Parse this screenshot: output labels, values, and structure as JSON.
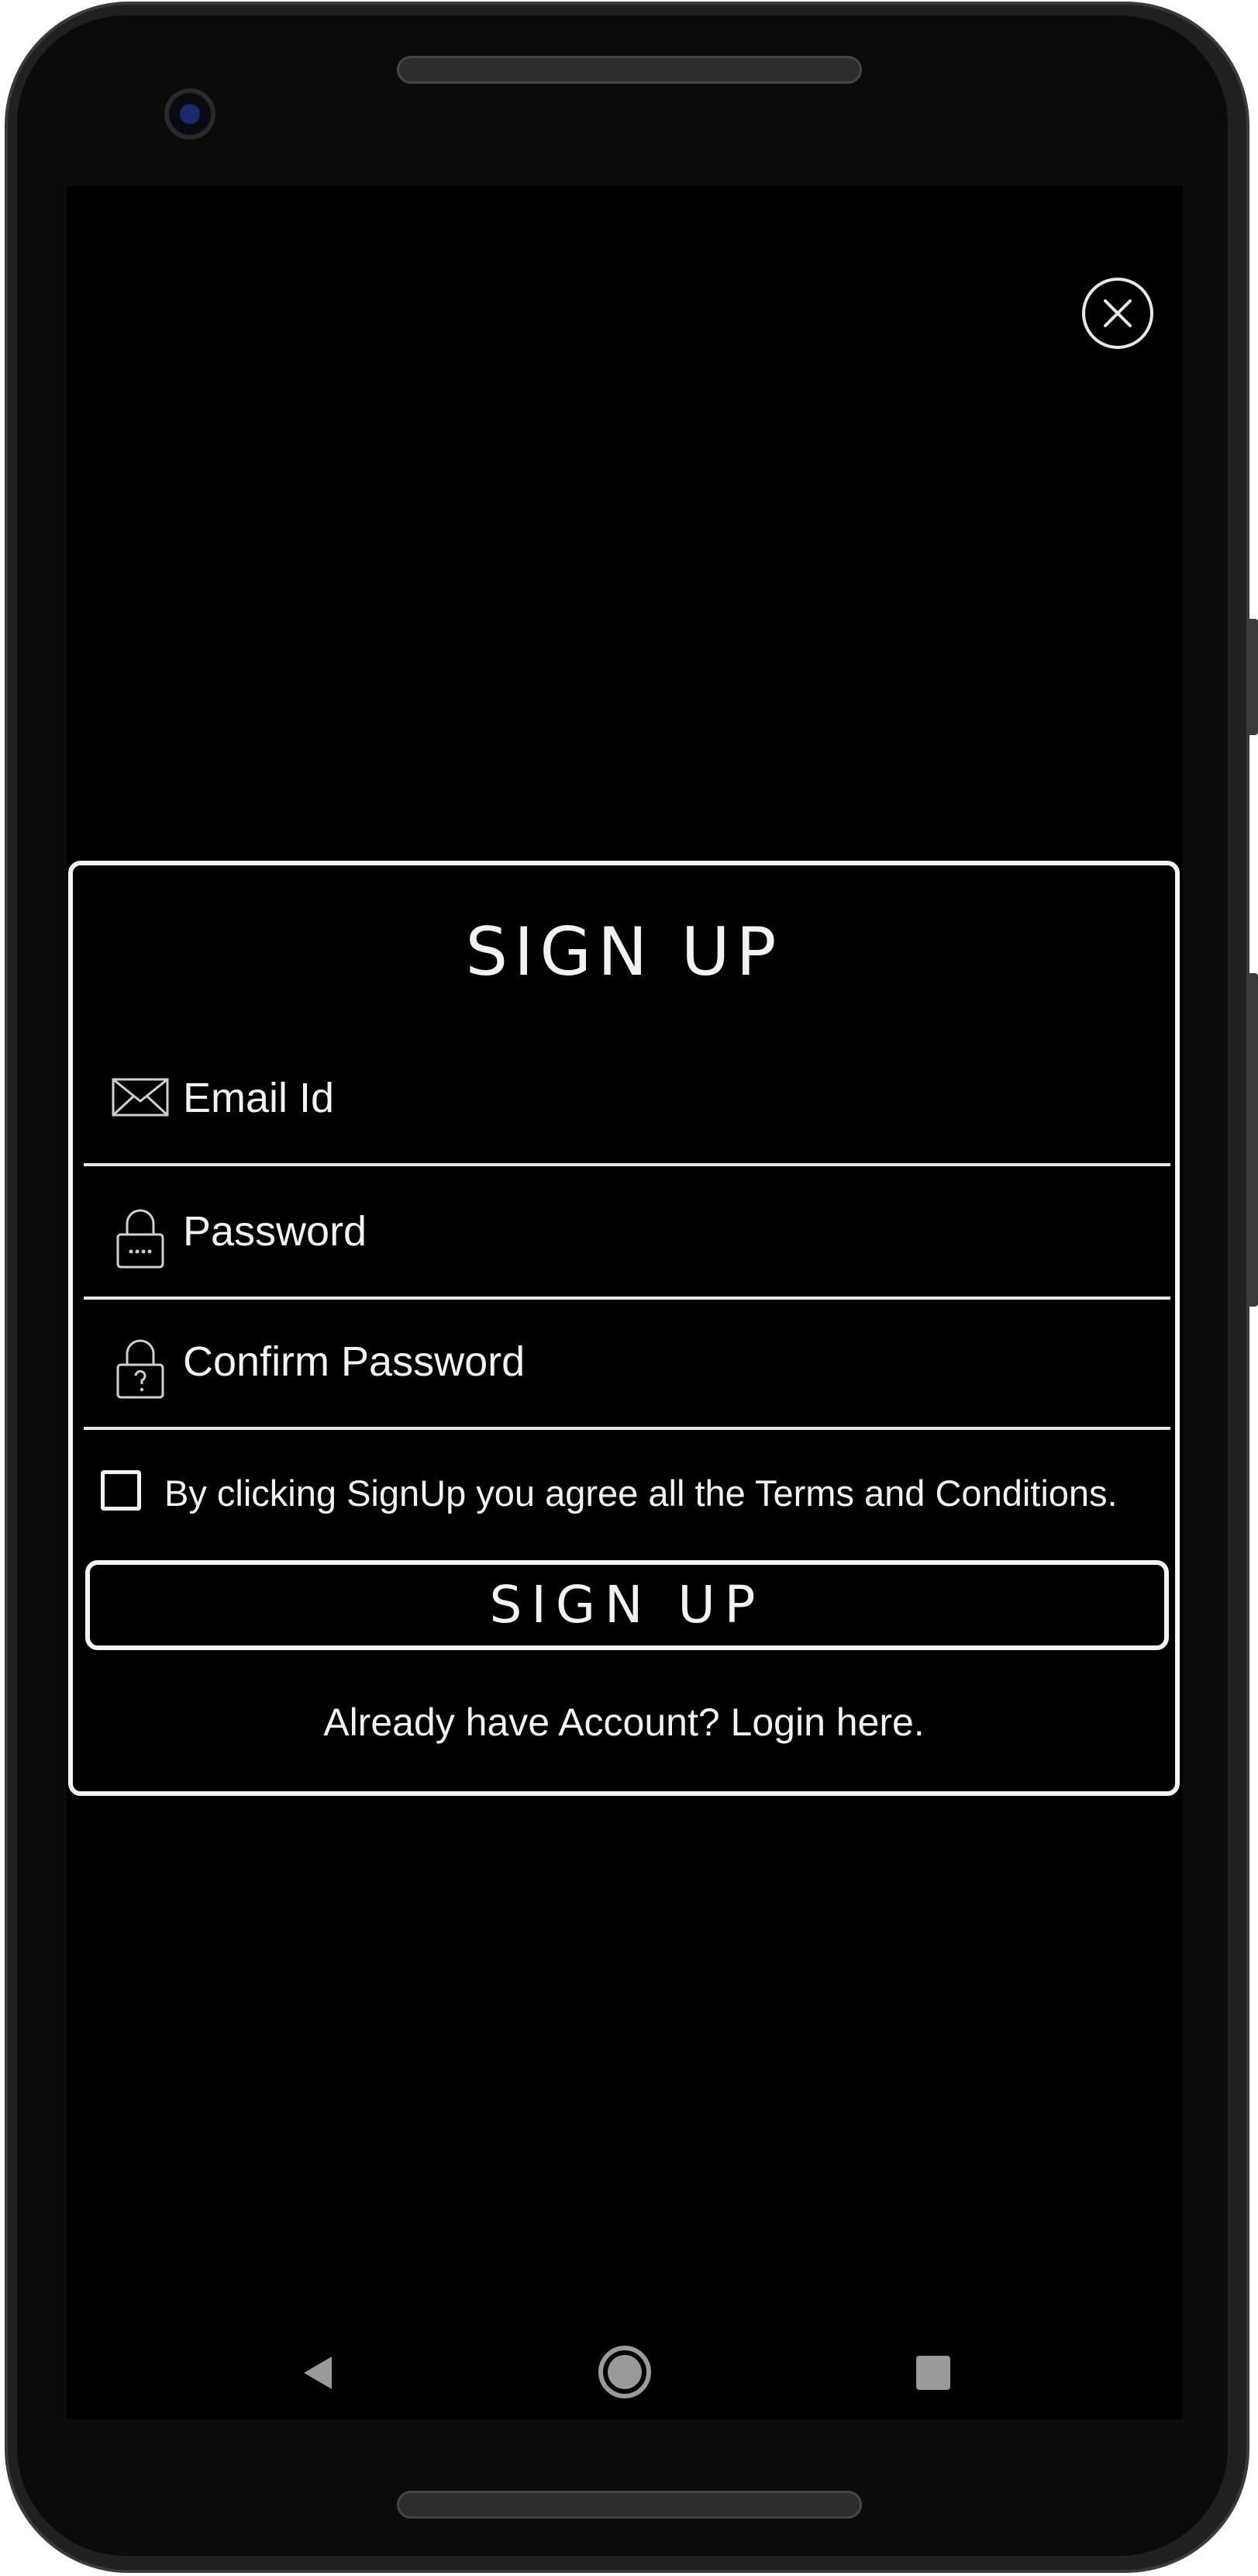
{
  "signup": {
    "title": "SIGN UP",
    "email_placeholder": "Email Id",
    "password_placeholder": "Password",
    "confirm_password_placeholder": "Confirm Password",
    "terms_text": "By clicking SignUp you agree all the Terms and Conditions.",
    "terms_checked": false,
    "submit_label": "SIGN UP",
    "login_prompt": "Already have Account? Login here."
  },
  "icons": {
    "close": "close-icon",
    "email": "envelope-icon",
    "password": "lock-icon",
    "confirm_password": "lock-question-icon",
    "nav_back": "back-triangle-icon",
    "nav_home": "home-circle-icon",
    "nav_recent": "recent-apps-square-icon"
  },
  "colors": {
    "background": "#000000",
    "foreground": "#f2f2f2",
    "nav_icons": "#9a9a9a"
  }
}
